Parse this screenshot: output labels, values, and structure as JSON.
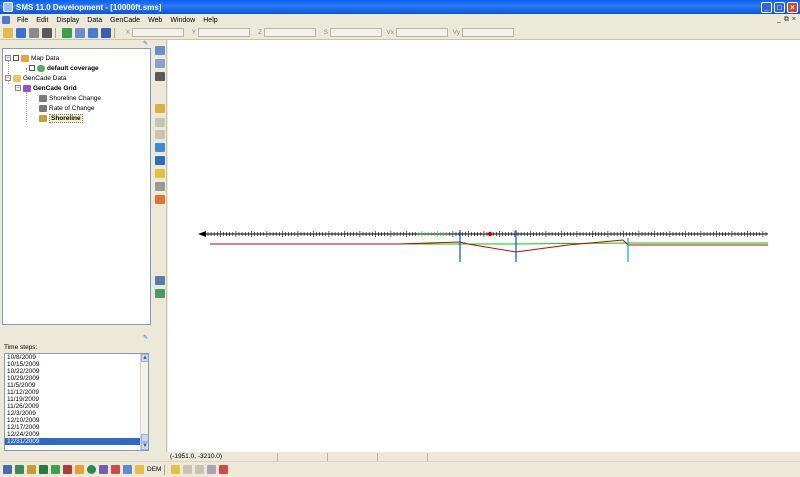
{
  "window": {
    "title": "SMS 11.0 Development - [10000ft.sms]",
    "min_label": "_",
    "max_label": "□",
    "close_label": "×"
  },
  "menu": {
    "items": [
      "File",
      "Edit",
      "Display",
      "Data",
      "GenCade",
      "Web",
      "Window",
      "Help"
    ],
    "mdi_min": "_",
    "mdi_restore": "⧉",
    "mdi_close": "×"
  },
  "toolbar": {
    "coord_labels": [
      "X",
      "Y",
      "Z",
      "S",
      "Vx",
      "Vy"
    ]
  },
  "tree": {
    "map_data": "Map Data",
    "default_coverage": "default coverage",
    "gencade_data": "GenCade Data",
    "gencade_grid": "GenCade Grid",
    "shoreline_change": "Shoreline Change",
    "rate_of_change": "Rate of Change",
    "shoreline": "Shoreline"
  },
  "time_steps": {
    "label": "Time steps:",
    "items": [
      "10/8/2009",
      "10/15/2009",
      "10/22/2009",
      "10/29/2009",
      "11/5/2009",
      "11/12/2009",
      "11/19/2009",
      "11/26/2009",
      "12/3/2009",
      "12/10/2009",
      "12/17/2009",
      "12/24/2009",
      "12/31/2009"
    ],
    "selected": "12/31/2009"
  },
  "status": {
    "coordinates": "(-1951.0, -3210.0)"
  },
  "bottom": {
    "dem_label": "DEM"
  },
  "colors": {
    "grid_axis": "#000000",
    "initial_shoreline": "#00cc00",
    "current_shoreline": "#cc0000",
    "structure": "#0055cc",
    "structure_light": "#00aadd",
    "selection": "#316ac5"
  }
}
